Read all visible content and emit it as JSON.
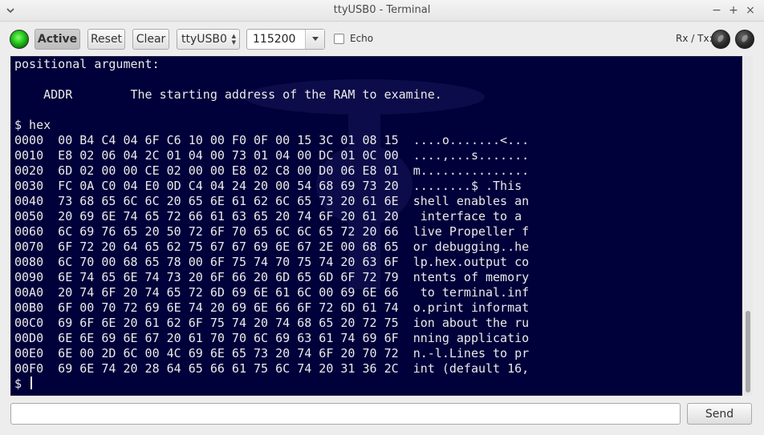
{
  "window": {
    "title": "ttyUSB0 - Terminal",
    "minimize": "−",
    "maximize": "+",
    "close": "×"
  },
  "toolbar": {
    "active_label": "Active",
    "reset_label": "Reset",
    "clear_label": "Clear",
    "port": "ttyUSB0",
    "baud": "115200",
    "echo_label": "Echo",
    "rxtx_label": "Rx / Tx:"
  },
  "terminal": {
    "lines": [
      "positional argument:",
      "",
      "    ADDR        The starting address of the RAM to examine.",
      "",
      "$ hex",
      "0000  00 B4 C4 04 6F C6 10 00 F0 0F 00 15 3C 01 08 15  ....o.......<...",
      "0010  E8 02 06 04 2C 01 04 00 73 01 04 00 DC 01 0C 00  ....,...s.......",
      "0020  6D 02 00 00 CE 02 00 00 E8 02 C8 00 D0 06 E8 01  m...............",
      "0030  FC 0A C0 04 E0 0D C4 04 24 20 00 54 68 69 73 20  ........$ .This ",
      "0040  73 68 65 6C 6C 20 65 6E 61 62 6C 65 73 20 61 6E  shell enables an",
      "0050  20 69 6E 74 65 72 66 61 63 65 20 74 6F 20 61 20   interface to a ",
      "0060  6C 69 76 65 20 50 72 6F 70 65 6C 6C 65 72 20 66  live Propeller f",
      "0070  6F 72 20 64 65 62 75 67 67 69 6E 67 2E 00 68 65  or debugging..he",
      "0080  6C 70 00 68 65 78 00 6F 75 74 70 75 74 20 63 6F  lp.hex.output co",
      "0090  6E 74 65 6E 74 73 20 6F 66 20 6D 65 6D 6F 72 79  ntents of memory",
      "00A0  20 74 6F 20 74 65 72 6D 69 6E 61 6C 00 69 6E 66   to terminal.inf",
      "00B0  6F 00 70 72 69 6E 74 20 69 6E 66 6F 72 6D 61 74  o.print informat",
      "00C0  69 6F 6E 20 61 62 6F 75 74 20 74 68 65 20 72 75  ion about the ru",
      "00D0  6E 6E 69 6E 67 20 61 70 70 6C 69 63 61 74 69 6F  nning applicatio",
      "00E0  6E 00 2D 6C 00 4C 69 6E 65 73 20 74 6F 20 70 72  n.-l.Lines to pr",
      "00F0  69 6E 74 20 28 64 65 66 61 75 6C 74 20 31 36 2C  int (default 16,"
    ],
    "prompt": "$ "
  },
  "input": {
    "value": "",
    "send_label": "Send"
  },
  "colors": {
    "terminal_bg": "#00003a",
    "terminal_fg": "#eaeaea",
    "led_active": "#1fbf16"
  }
}
